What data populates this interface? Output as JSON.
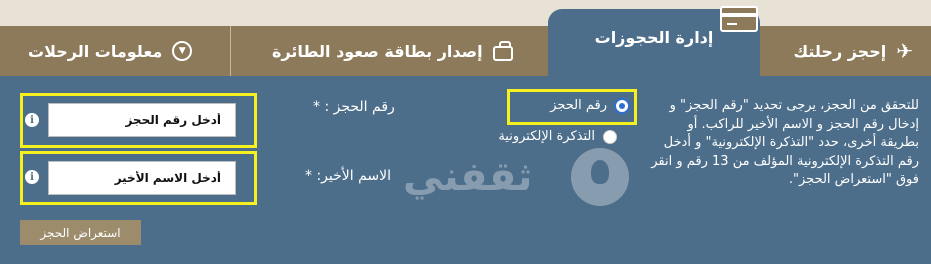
{
  "tabs": {
    "book": "إحجز رحلتك",
    "manage": "إدارة الحجوزات",
    "boarding": "إصدار بطاقة صعود الطائرة",
    "info": "معلومات الرحلات"
  },
  "icons": {
    "book": "airplane-icon",
    "manage": "card-icon",
    "boarding": "suitcase-icon",
    "info": "chevron-down-icon"
  },
  "instructions": "للتحقق من الحجز، يرجى تحديد \"رقم الحجز\" و إدخال رقم الحجز و الاسم الأخير للراكب. أو بطريقة أخرى، حدد \"التذكرة الإلكترونية\" و أدخل رقم التذكرة الإلكترونية المؤلف من 13 رقم و انقر فوق \"استعراض الحجز\".",
  "options": {
    "booking_ref": "رقم الحجز",
    "eticket": "التذكرة الإلكترونية",
    "selected": "booking_ref"
  },
  "fields": {
    "ref_label": "رقم الحجز : *",
    "ref_placeholder": "أدخل رقم الحجز",
    "name_label": "الاسم الأخير: *",
    "name_placeholder": "أدخل الاسم الأخير"
  },
  "watermark": "ثقفني",
  "submit_label": "استعراض الحجز",
  "colors": {
    "panel": "#4d6e8a",
    "tabbar": "#8d7a5a",
    "highlight": "#f4f11f",
    "button": "#9c8c6c"
  }
}
